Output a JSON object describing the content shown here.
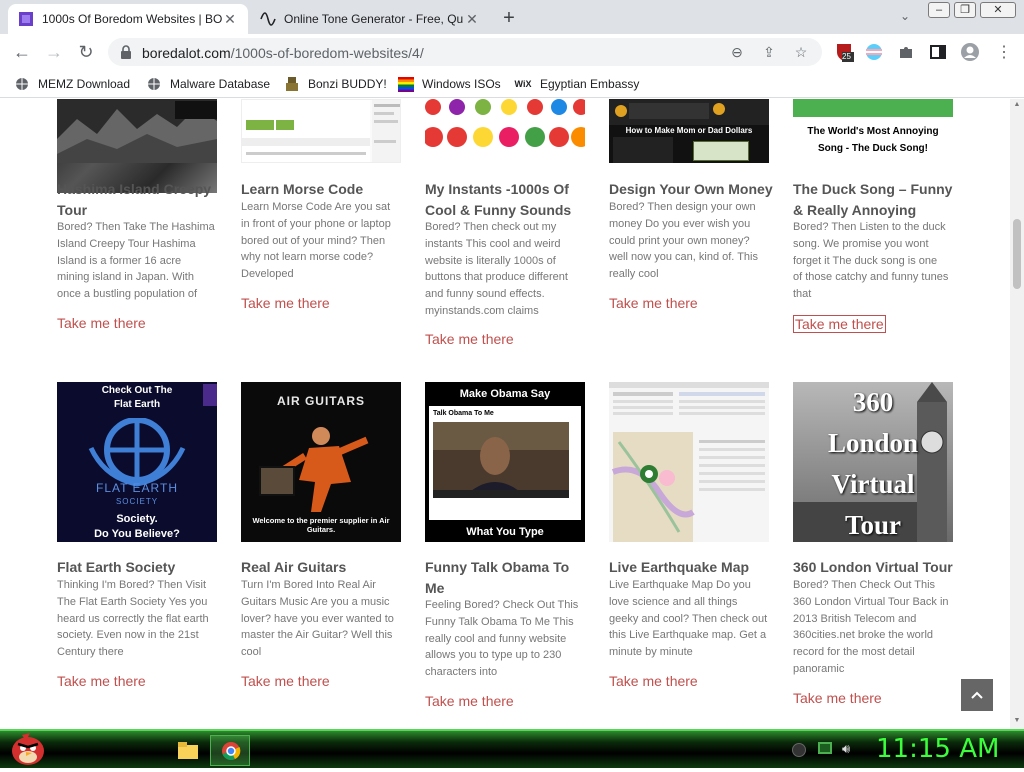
{
  "tabs": [
    {
      "title": "1000s Of Boredom Websites | BO",
      "active": true
    },
    {
      "title": "Online Tone Generator - Free, Qu",
      "active": false
    }
  ],
  "address": {
    "domain": "boredalot.com",
    "path": "/1000s-of-boredom-websites/4/"
  },
  "extension_badge": "25",
  "bookmarks": [
    {
      "label": "MEMZ Download",
      "icon": "globe-icon"
    },
    {
      "label": "Malware Database",
      "icon": "globe-icon"
    },
    {
      "label": "Bonzi BUDDY!",
      "icon": "bonzi-icon"
    },
    {
      "label": "Windows ISOs",
      "icon": "windows-flag-icon"
    },
    {
      "label": "Egyptian Embassy",
      "icon": "wix-icon"
    }
  ],
  "row1": [
    {
      "title_lines": [
        "Hashima Island Creepy",
        "Tour"
      ],
      "desc_lines": [
        "Bored? Then Take The Hashima",
        "Island Creepy Tour Hashima",
        "Island is a former 16 acre",
        "mining island in Japan.  With",
        "once a bustling population of"
      ],
      "more": "Take me there"
    },
    {
      "title_lines": [
        "Learn Morse Code"
      ],
      "desc_lines": [
        "Learn Morse Code Are you sat",
        "in front of your phone or laptop",
        "bored out of your mind? Then",
        "why not learn morse code?",
        "Developed"
      ],
      "more": "Take me there"
    },
    {
      "title_lines": [
        "My Instants -1000s Of",
        "Cool & Funny Sounds"
      ],
      "desc_lines": [
        "Bored? Then check out my",
        "instants This cool and weird",
        "website is literally 1000s of",
        "buttons that produce different",
        "and funny sound effects.",
        "myinstands.com claims"
      ],
      "more": "Take me there"
    },
    {
      "title_lines": [
        "Design Your Own Money"
      ],
      "desc_lines": [
        "Bored? Then design your own",
        "money Do you ever wish you",
        "could print your own money?",
        "well now you can, kind of. This",
        "really cool"
      ],
      "more": "Take me there",
      "thumb_text": "How to Make Mom or Dad Dollars"
    },
    {
      "title_lines": [
        "The Duck Song – Funny",
        "& Really Annoying"
      ],
      "desc_lines": [
        "Bored? Then Listen to the duck",
        "song. We promise you wont",
        "forget it The duck song is one",
        "of those catchy and funny tunes",
        "that"
      ],
      "more": "Take me there",
      "thumb_text_lines": [
        "The World's Most Annoying",
        "Song - The Duck Song!"
      ]
    }
  ],
  "row2": [
    {
      "title_lines": [
        "Flat Earth Society"
      ],
      "desc_lines": [
        "Thinking I'm Bored? Then Visit",
        "The Flat Earth Society Yes you",
        "heard us correctly the flat earth",
        "society. Even now in the 21st",
        "Century there"
      ],
      "more": "Take me there",
      "thumb_top_lines": [
        "Check Out The",
        "Flat Earth"
      ],
      "thumb_mid_lines": [
        "FLAT EARTH",
        "SOCIETY"
      ],
      "thumb_bottom_lines": [
        "Society.",
        "Do You Believe?"
      ]
    },
    {
      "title_lines": [
        "Real Air Guitars"
      ],
      "desc_lines": [
        "Turn I'm Bored Into Real Air",
        "Guitars Music Are you a music",
        "lover? have you ever wanted to",
        "master the Air Guitar?  Well this",
        "cool"
      ],
      "more": "Take me there",
      "thumb_logo": "AIR GUITARS",
      "thumb_caption": "Welcome to the premier supplier in Air Guitars."
    },
    {
      "title_lines": [
        "Funny Talk Obama To",
        "Me"
      ],
      "desc_lines": [
        "Feeling Bored? Check Out This",
        "Funny Talk Obama To Me This",
        "really cool and funny website",
        "allows you to type up to 230",
        "characters into"
      ],
      "more": "Take me there",
      "thumb_top": "Make Obama Say",
      "thumb_sub": "Talk Obama To Me",
      "thumb_bottom": "What You Type"
    },
    {
      "title_lines": [
        "Live Earthquake Map"
      ],
      "desc_lines": [
        "Live Earthquake Map Do you",
        "love science and all things",
        "geeky and cool? Then check out",
        "this Live Earthquake map. Get a",
        "minute by minute"
      ],
      "more": "Take me there"
    },
    {
      "title_lines": [
        "360 London Virtual Tour"
      ],
      "desc_lines": [
        "Bored? Then Check Out This",
        "360 London Virtual Tour Back in",
        "2013 British Telecom and",
        "360cities.net broke the world",
        "record for the most detail",
        "panoramic"
      ],
      "more": "Take me there",
      "thumb_text_lines": [
        "360",
        "London",
        "Virtual",
        "Tour"
      ]
    }
  ],
  "clock": "11:15 AM"
}
